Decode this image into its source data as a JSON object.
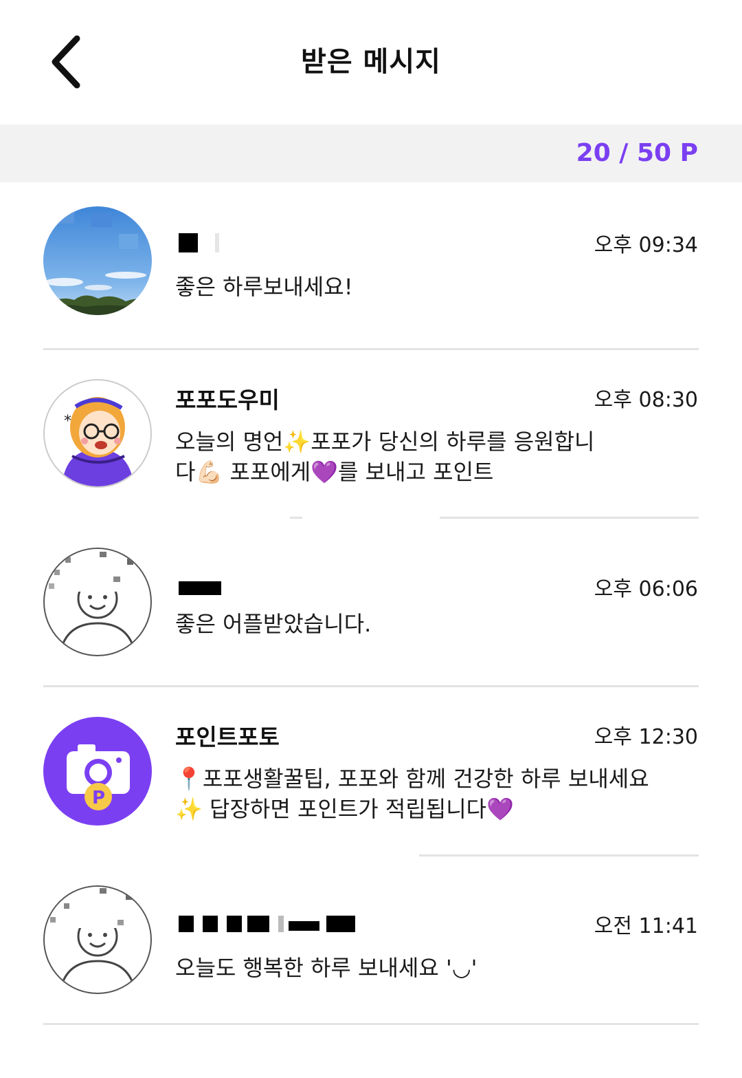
{
  "header": {
    "title": "받은 메시지"
  },
  "points": {
    "value": "20 / 50 P",
    "color": "#7b3ff2"
  },
  "messages": [
    {
      "sender": "",
      "time": "오후 09:34",
      "preview": "좋은 하루보내세요!",
      "avatar": "landscape-photo"
    },
    {
      "sender": "포포도우미",
      "time": "오후 08:30",
      "preview": "오늘의 명언✨포포가 당신의 하루를 응원합니다💪🏻 포포에게💜를 보내고 포인트",
      "avatar": "helper-character"
    },
    {
      "sender": "",
      "time": "오후 06:06",
      "preview": "좋은 어플받았습니다.",
      "avatar": "default-user"
    },
    {
      "sender": "포인트포토",
      "time": "오후 12:30",
      "preview": "📍포포생활꿀팁, 포포와 함께 건강한 하루 보내세요✨ 답장하면 포인트가 적립됩니다💜",
      "avatar": "camera-logo"
    },
    {
      "sender": "",
      "time": "오전 11:41",
      "preview": "오늘도 행복한 하루 보내세요 '◡'",
      "avatar": "default-user"
    }
  ]
}
